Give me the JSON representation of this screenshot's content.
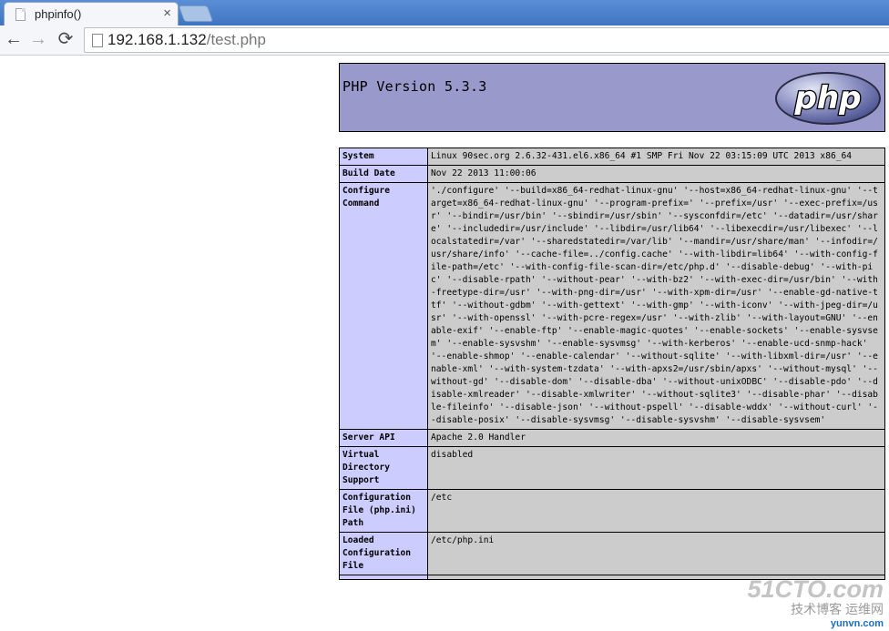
{
  "browser": {
    "tab_title": "phpinfo()",
    "tab_close": "×",
    "url_host": "192.168.1.132",
    "url_path": "/test.php",
    "back_glyph": "←",
    "forward_glyph": "→",
    "reload_glyph": "⟳"
  },
  "phpinfo": {
    "version_title": "PHP Version 5.3.3",
    "logo_text": "php",
    "rows": [
      {
        "key": "System",
        "value": "Linux 90sec.org 2.6.32-431.el6.x86_64 #1 SMP Fri Nov 22 03:15:09 UTC 2013 x86_64"
      },
      {
        "key": "Build Date",
        "value": "Nov 22 2013 11:00:06"
      },
      {
        "key": "Configure Command",
        "value": "'./configure' '--build=x86_64-redhat-linux-gnu' '--host=x86_64-redhat-linux-gnu' '--target=x86_64-redhat-linux-gnu' '--program-prefix=' '--prefix=/usr' '--exec-prefix=/usr' '--bindir=/usr/bin' '--sbindir=/usr/sbin' '--sysconfdir=/etc' '--datadir=/usr/share' '--includedir=/usr/include' '--libdir=/usr/lib64' '--libexecdir=/usr/libexec' '--localstatedir=/var' '--sharedstatedir=/var/lib' '--mandir=/usr/share/man' '--infodir=/usr/share/info' '--cache-file=../config.cache' '--with-libdir=lib64' '--with-config-file-path=/etc' '--with-config-file-scan-dir=/etc/php.d' '--disable-debug' '--with-pic' '--disable-rpath' '--without-pear' '--with-bz2' '--with-exec-dir=/usr/bin' '--with-freetype-dir=/usr' '--with-png-dir=/usr' '--with-xpm-dir=/usr' '--enable-gd-native-ttf' '--without-gdbm' '--with-gettext' '--with-gmp' '--with-iconv' '--with-jpeg-dir=/usr' '--with-openssl' '--with-pcre-regex=/usr' '--with-zlib' '--with-layout=GNU' '--enable-exif' '--enable-ftp' '--enable-magic-quotes' '--enable-sockets' '--enable-sysvsem' '--enable-sysvshm' '--enable-sysvmsg' '--with-kerberos' '--enable-ucd-snmp-hack' '--enable-shmop' '--enable-calendar' '--without-sqlite' '--with-libxml-dir=/usr' '--enable-xml' '--with-system-tzdata' '--with-apxs2=/usr/sbin/apxs' '--without-mysql' '--without-gd' '--disable-dom' '--disable-dba' '--without-unixODBC' '--disable-pdo' '--disable-xmlreader' '--disable-xmlwriter' '--without-sqlite3' '--disable-phar' '--disable-fileinfo' '--disable-json' '--without-pspell' '--disable-wddx' '--without-curl' '--disable-posix' '--disable-sysvmsg' '--disable-sysvshm' '--disable-sysvsem'"
      },
      {
        "key": "Server API",
        "value": "Apache 2.0 Handler"
      },
      {
        "key": "Virtual Directory Support",
        "value": "disabled"
      },
      {
        "key": "Configuration File (php.ini) Path",
        "value": "/etc"
      },
      {
        "key": "Loaded Configuration File",
        "value": "/etc/php.ini"
      },
      {
        "key": "",
        "value": ""
      }
    ]
  },
  "watermark": {
    "line1": "51CTO.com",
    "line2": "技术博客 运维网",
    "line3": "yunvn.com"
  }
}
